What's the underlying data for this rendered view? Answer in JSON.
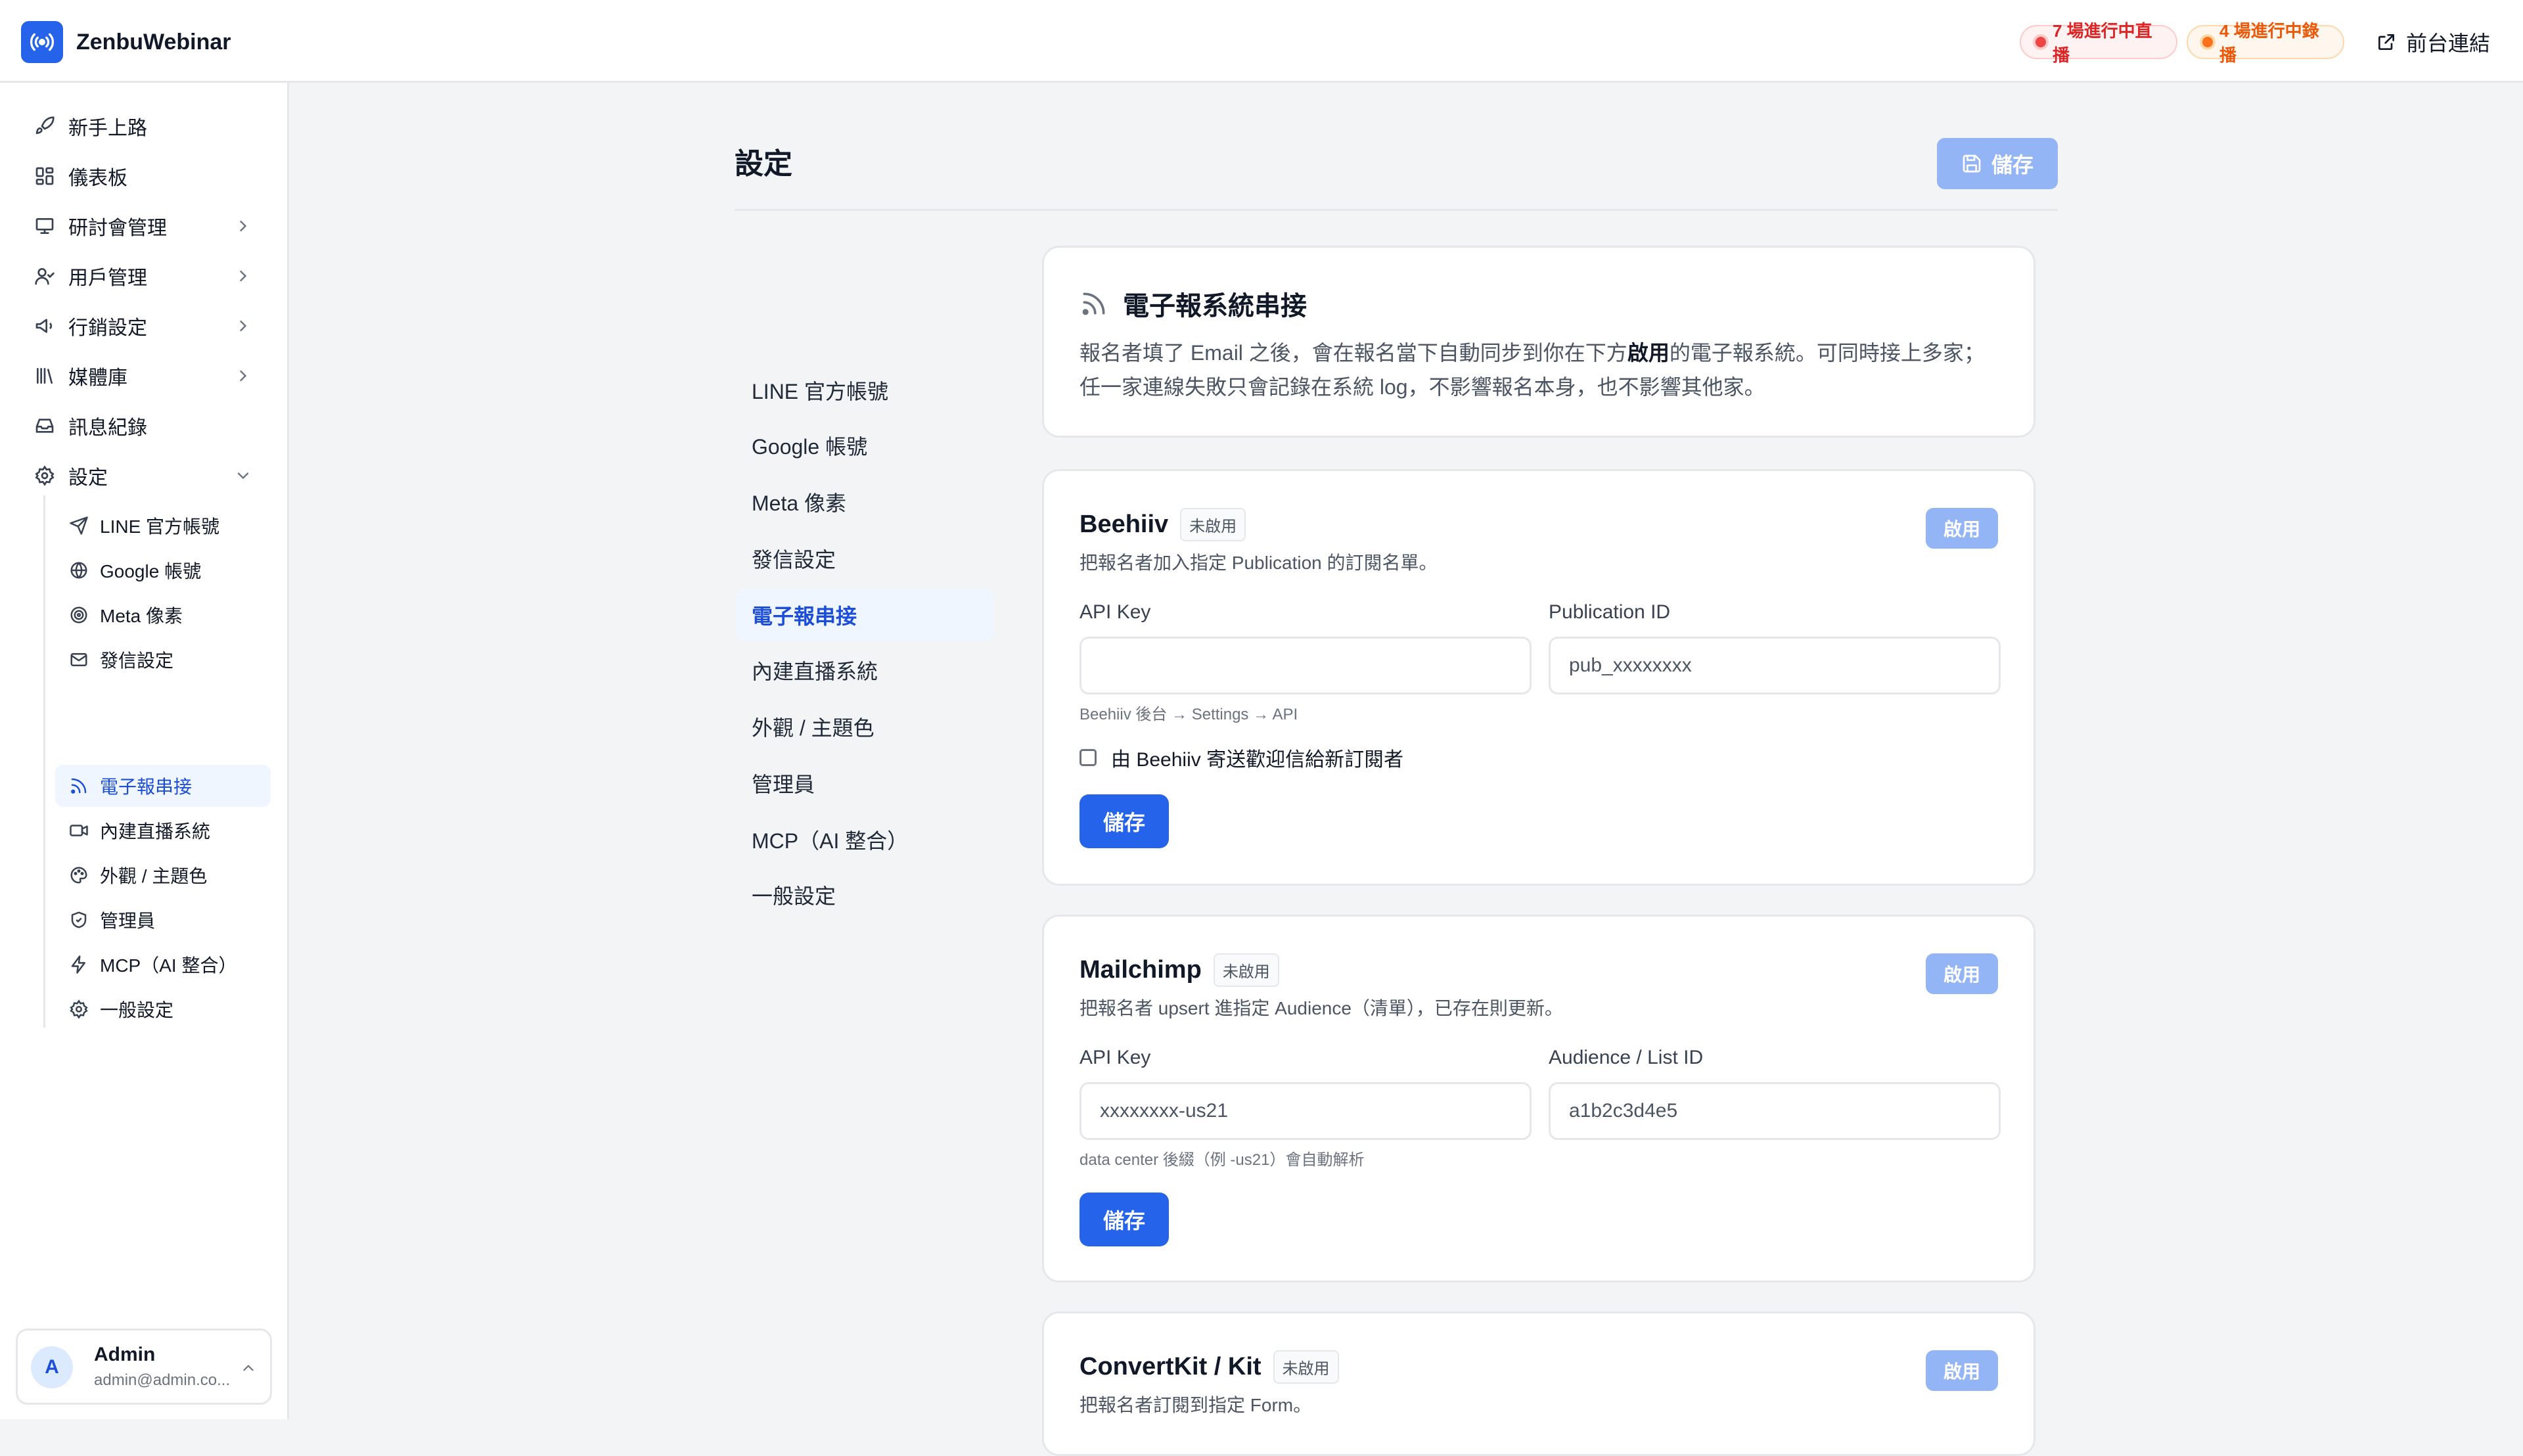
{
  "app": {
    "name": "ZenbuWebinar"
  },
  "header": {
    "live_badge": "7 場進行中直播",
    "rec_badge": "4 場進行中錄播",
    "front_link": "前台連結",
    "colors": {
      "live": "#dc2626",
      "rec": "#ea580c"
    }
  },
  "sidebar": {
    "items": [
      {
        "label": "新手上路",
        "icon": "rocket-icon"
      },
      {
        "label": "儀表板",
        "icon": "dashboard-icon"
      },
      {
        "label": "研討會管理",
        "icon": "presentation-icon"
      },
      {
        "label": "用戶管理",
        "icon": "users-icon"
      },
      {
        "label": "行銷設定",
        "icon": "megaphone-icon"
      },
      {
        "label": "媒體庫",
        "icon": "library-icon"
      },
      {
        "label": "訊息紀錄",
        "icon": "inbox-icon"
      },
      {
        "label": "設定",
        "icon": "gear-icon"
      }
    ],
    "sub_items": [
      {
        "label": "LINE 官方帳號",
        "icon": "send-icon"
      },
      {
        "label": "Google 帳號",
        "icon": "globe-icon"
      },
      {
        "label": "Meta 像素",
        "icon": "target-icon"
      },
      {
        "label": "發信設定",
        "icon": "mail-icon"
      },
      {
        "label": "電子報串接",
        "icon": "rss-icon"
      },
      {
        "label": "內建直播系統",
        "icon": "video-icon"
      },
      {
        "label": "外觀 / 主題色",
        "icon": "palette-icon"
      },
      {
        "label": "管理員",
        "icon": "shield-icon"
      },
      {
        "label": "MCP（AI 整合）",
        "icon": "bolt-icon"
      },
      {
        "label": "一般設定",
        "icon": "cog-icon"
      }
    ],
    "user": {
      "initial": "A",
      "name": "Admin",
      "email": "admin@admin.co..."
    }
  },
  "page": {
    "title": "設定",
    "save_label": "儲存"
  },
  "settings_nav": [
    "LINE 官方帳號",
    "Google 帳號",
    "Meta 像素",
    "發信設定",
    "電子報串接",
    "內建直播系統",
    "外觀 / 主題色",
    "管理員",
    "MCP（AI 整合）",
    "一般設定"
  ],
  "intro": {
    "title": "電子報系統串接",
    "desc_pre": "報名者填了 Email 之後，會在報名當下自動同步到你在下方",
    "desc_bold": "啟用",
    "desc_post": "的電子報系統。可同時接上多家； 任一家連線失敗只會記錄在系統 log，不影響報名本身，也不影響其他家。"
  },
  "providers": {
    "beehiiv": {
      "name": "Beehiiv",
      "status": "未啟用",
      "enable_label": "啟用",
      "desc": "把報名者加入指定 Publication 的訂閱名單。",
      "api_key_label": "API Key",
      "api_key_value": "",
      "pub_label": "Publication ID",
      "pub_placeholder": "pub_xxxxxxxx",
      "hint": "Beehiiv 後台 → Settings → API",
      "checkbox_label": "由 Beehiiv 寄送歡迎信給新訂閱者",
      "save_label": "儲存"
    },
    "mailchimp": {
      "name": "Mailchimp",
      "status": "未啟用",
      "enable_label": "啟用",
      "desc": "把報名者 upsert 進指定 Audience（清單），已存在則更新。",
      "api_key_label": "API Key",
      "api_key_placeholder": "xxxxxxxx-us21",
      "list_label": "Audience / List ID",
      "list_placeholder": "a1b2c3d4e5",
      "hint": "data center 後綴（例 -us21）會自動解析",
      "save_label": "儲存"
    },
    "convertkit": {
      "name": "ConvertKit / Kit",
      "status": "未啟用",
      "enable_label": "啟用",
      "desc": "把報名者訂閱到指定 Form。"
    }
  }
}
